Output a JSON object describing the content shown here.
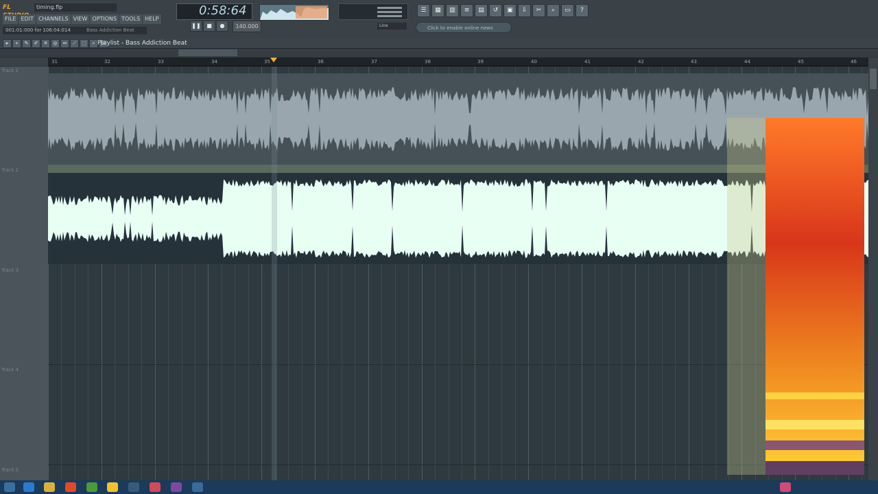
{
  "app": {
    "logo": "FL STUDIO",
    "filename": "timing.flp",
    "menus": [
      "FILE",
      "EDIT",
      "CHANNELS",
      "VIEW",
      "OPTIONS",
      "TOOLS",
      "HELP"
    ],
    "hint_left": "001:01:000 for 106:04:014",
    "hint_right": "Bass Addiction Beat",
    "time_display": "0:58:64",
    "tempo": "140.000",
    "line_mode": "Line",
    "news": "Click to enable online news"
  },
  "transport": {
    "pause_icon": "pause-icon",
    "stop_icon": "stop-icon",
    "record_icon": "record-icon"
  },
  "playlist": {
    "title": "Playlist - Bass Addiction Beat",
    "ruler_ticks": [
      "31",
      "32",
      "33",
      "34",
      "35",
      "36",
      "37",
      "38",
      "39",
      "40",
      "41",
      "42",
      "43",
      "44",
      "45",
      "46"
    ],
    "tracks": [
      "Track 1",
      "Track 2",
      "Track 3",
      "Track 4",
      "Track 5"
    ]
  },
  "colors": {
    "audio_clip_1": "#9aa6ad",
    "audio_clip_2": "#e8fff4",
    "spectrum_hot": "#ffd23a",
    "spectrum_mid": "#e0461a",
    "spectrum_cold": "#4a2a8a"
  }
}
